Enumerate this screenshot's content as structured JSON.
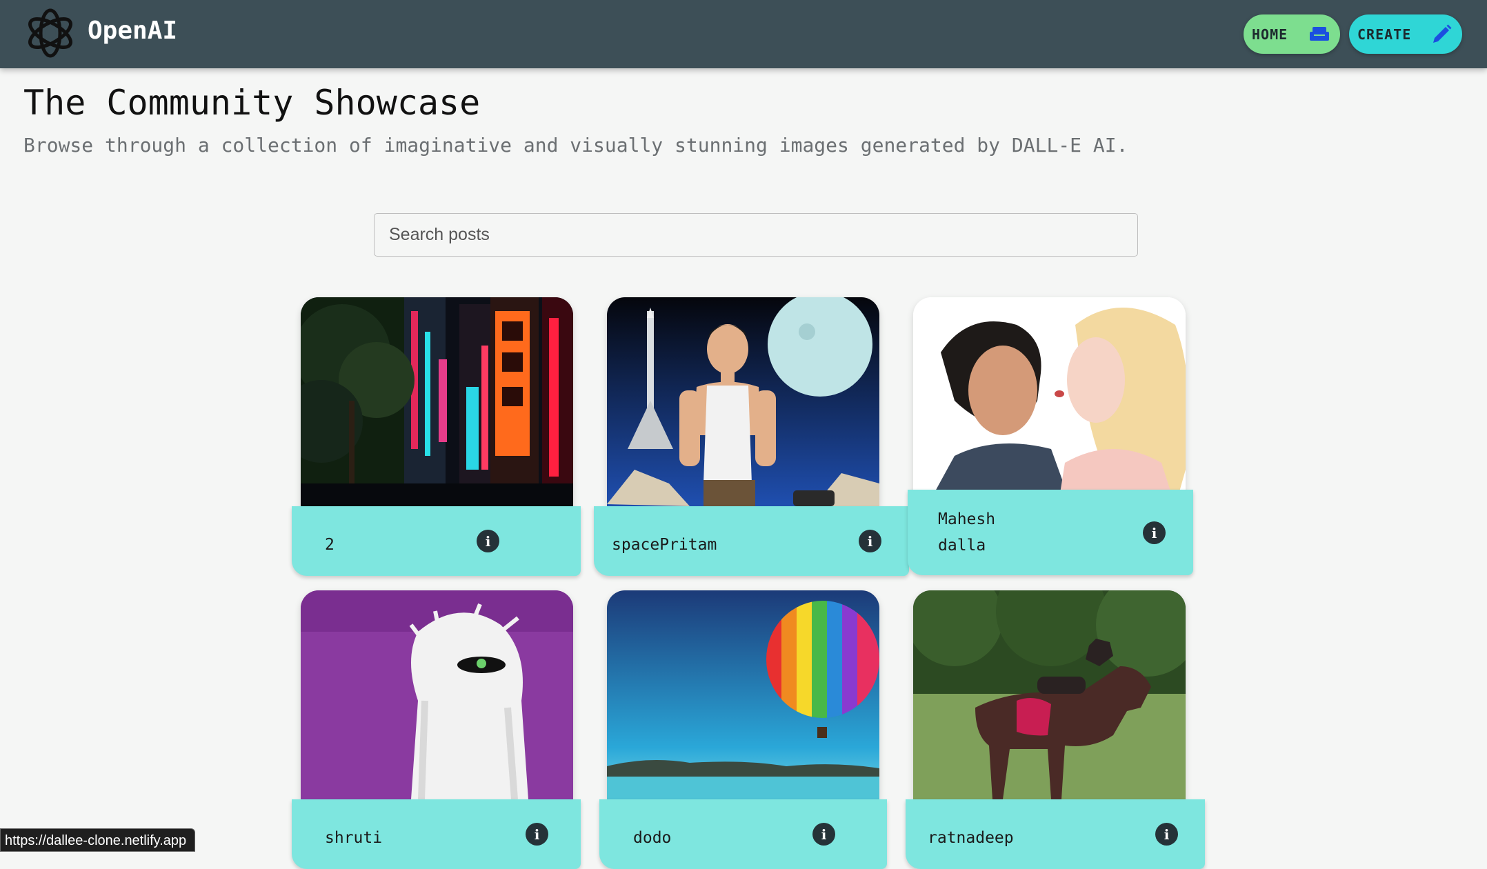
{
  "navbar": {
    "brand": "OpenAI",
    "logo_icon": "openai-logo-icon",
    "home_label": "HOME",
    "home_icon": "sofa-icon",
    "create_label": "CREATE",
    "create_icon": "pencil-icon",
    "colors": {
      "bar": "#3d4f57",
      "home": "#7dde8f",
      "create": "#2fd6d6",
      "icon": "#1b4fe0"
    }
  },
  "header": {
    "title": "The Community Showcase",
    "subtitle": "Browse through a collection of imaginative and visually stunning images generated by DALL-E AI."
  },
  "search": {
    "placeholder": "Search posts",
    "value": ""
  },
  "posts": [
    {
      "author": "2",
      "image": "neon city street at night",
      "info_icon": "info-icon"
    },
    {
      "author": "spacePritam",
      "image": "man with rocket and moon",
      "info_icon": "info-icon"
    },
    {
      "author_line1": "Mahesh",
      "author_line2": "dalla",
      "image": "couple kissing",
      "info_icon": "info-icon"
    },
    {
      "author": "shruti",
      "image": "white furry monster on purple",
      "info_icon": "info-icon"
    },
    {
      "author": "dodo",
      "image": "hot air balloon over lake",
      "info_icon": "info-icon"
    },
    {
      "author": "ratnadeep",
      "image": "dog riding a horse",
      "info_icon": "info-icon"
    }
  ],
  "card_footer_color": "#7ee6df",
  "status_bar": {
    "url": "https://dallee-clone.netlify.app"
  }
}
